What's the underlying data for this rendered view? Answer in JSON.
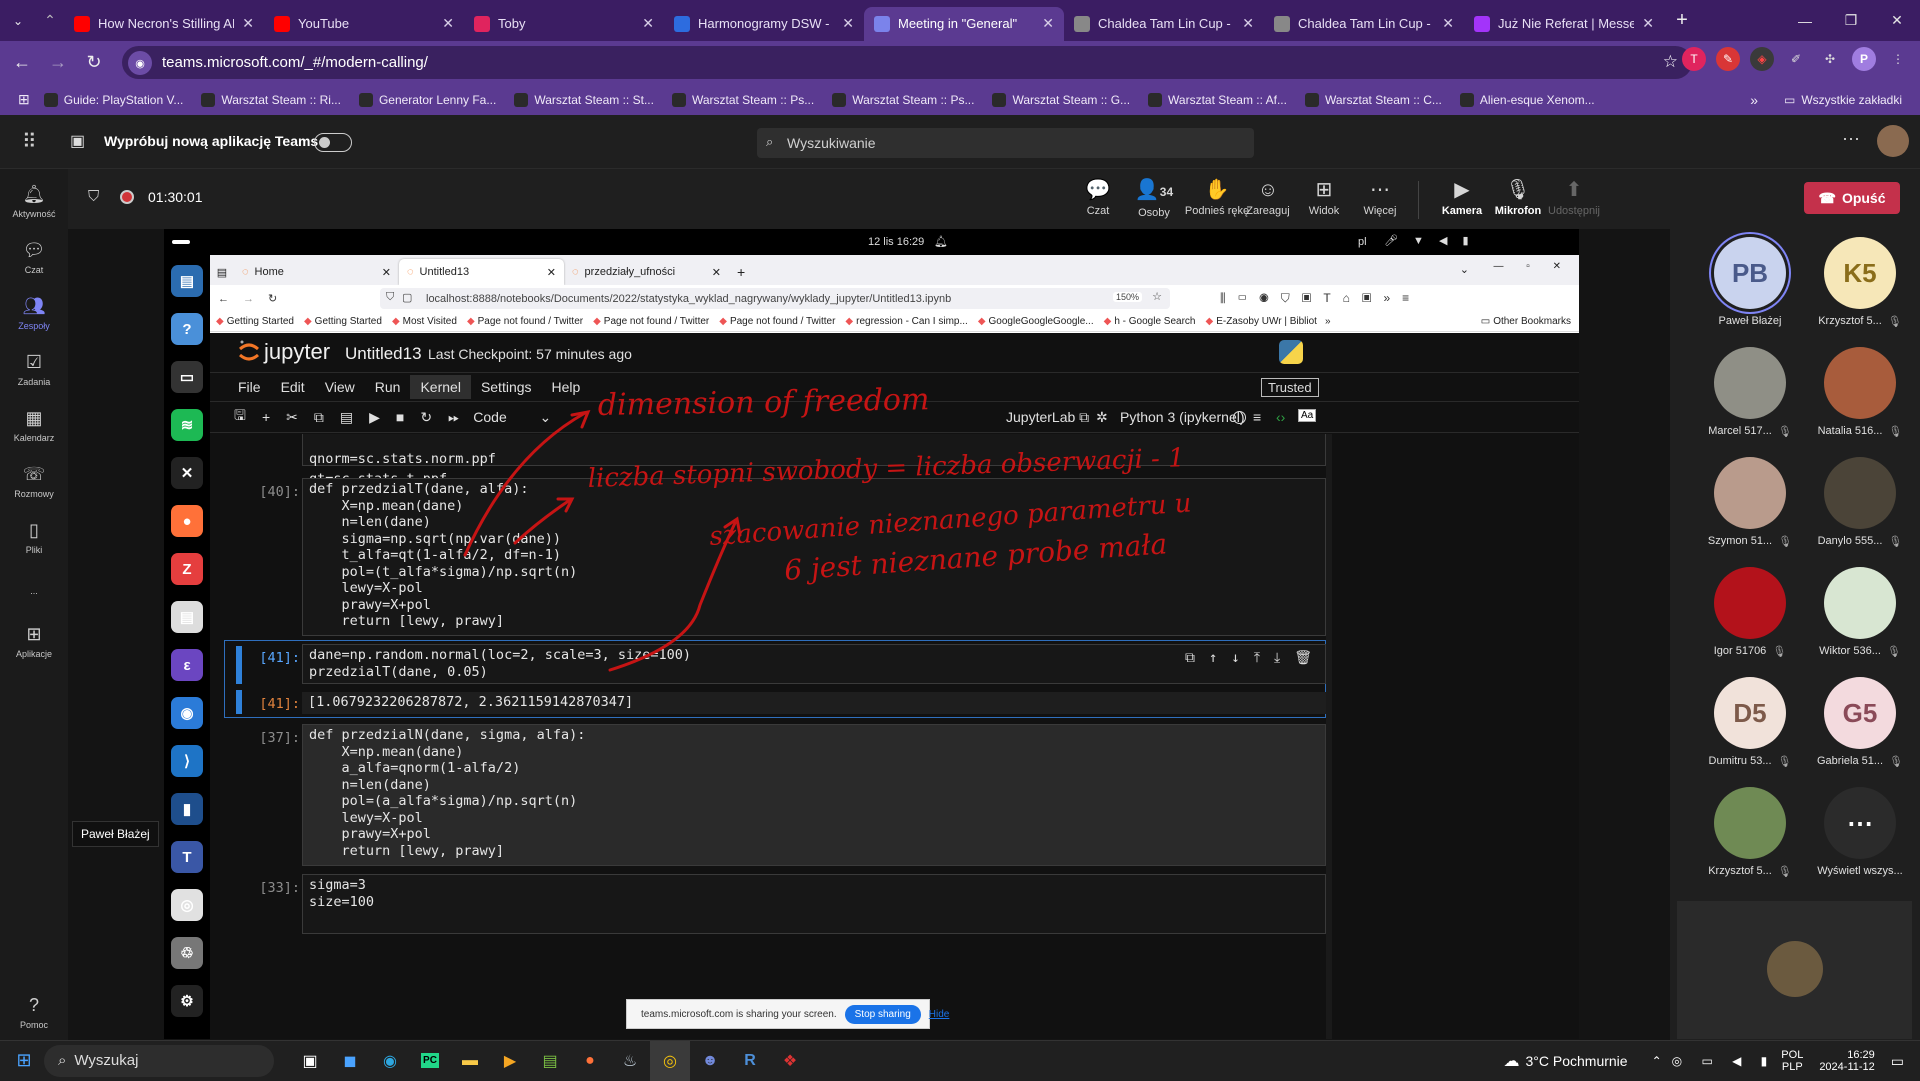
{
  "browser_tabs": [
    {
      "title": "How Necron's Stilling AF",
      "icon": "youtube-icon",
      "color": "#ff0000"
    },
    {
      "title": "YouTube",
      "icon": "youtube-icon",
      "color": "#ff0000"
    },
    {
      "title": "Toby",
      "icon": "toby-icon",
      "color": "#e0245e"
    },
    {
      "title": "Harmonogramy DSW - P",
      "icon": "wd-icon",
      "color": "#2d6cdf"
    },
    {
      "title": "Meeting in \"General\"",
      "icon": "teams-icon",
      "color": "#7b83eb"
    },
    {
      "title": "Chaldea Tam Lin Cup - W",
      "icon": "site-icon",
      "color": "#888888"
    },
    {
      "title": "Chaldea Tam Lin Cup - E",
      "icon": "site-icon",
      "color": "#888888"
    },
    {
      "title": "Już Nie Referat | Messen",
      "icon": "messenger-icon",
      "color": "#a334fa"
    }
  ],
  "address": {
    "url": "teams.microsoft.com/_#/modern-calling/"
  },
  "bookmarks": [
    "Guide: PlayStation V...",
    "Warsztat Steam :: Ri...",
    "Generator Lenny Fa...",
    "Warsztat Steam :: St...",
    "Warsztat Steam :: Ps...",
    "Warsztat Steam :: Ps...",
    "Warsztat Steam :: G...",
    "Warsztat Steam :: Af...",
    "Warsztat Steam :: C...",
    "Alien-esque Xenom..."
  ],
  "bookmarks_all": "Wszystkie zakładki",
  "teams": {
    "try_new": "Wypróbuj nową aplikację Teams",
    "search_placeholder": "Wyszukiwanie",
    "timer": "01:30:01",
    "rail": [
      {
        "label": "Aktywność",
        "icon": "bell-icon"
      },
      {
        "label": "Czat",
        "icon": "chat-icon"
      },
      {
        "label": "Zespoły",
        "icon": "teams-icon"
      },
      {
        "label": "Zadania",
        "icon": "tasks-icon"
      },
      {
        "label": "Kalendarz",
        "icon": "calendar-icon"
      },
      {
        "label": "Rozmowy",
        "icon": "phone-icon"
      },
      {
        "label": "Pliki",
        "icon": "files-icon"
      },
      {
        "label": "...",
        "icon": "more-icon"
      },
      {
        "label": "Aplikacje",
        "icon": "apps-icon"
      }
    ],
    "help": "Pomoc",
    "tooltip": "Paweł Błażej",
    "controls": {
      "chat": "Czat",
      "people": "Osoby",
      "people_count": "34",
      "raise": "Podnieś rękę",
      "react": "Zareaguj",
      "view": "Widok",
      "more": "Więcej",
      "camera": "Kamera",
      "mic": "Mikrofon",
      "share": "Udostępnij",
      "leave": "Opuść"
    }
  },
  "participants": [
    {
      "initials": "PB",
      "name": "Paweł Błażej",
      "bg": "#c9d3ee",
      "fg": "#4a5a8a"
    },
    {
      "initials": "K5",
      "name": "Krzysztof 5...",
      "bg": "#f6e7b8",
      "fg": "#8a6d1a"
    },
    {
      "initials": "",
      "name": "Marcel 517...",
      "bg": "#8f8f86",
      "fg": "#fff"
    },
    {
      "initials": "",
      "name": "Natalia 516...",
      "bg": "#a85c3c",
      "fg": "#fff"
    },
    {
      "initials": "",
      "name": "Szymon 51...",
      "bg": "#b99b8c",
      "fg": "#fff"
    },
    {
      "initials": "",
      "name": "Danylo 555...",
      "bg": "#4b4438",
      "fg": "#fff"
    },
    {
      "initials": "",
      "name": "Igor 51706",
      "bg": "#b3121b",
      "fg": "#fff"
    },
    {
      "initials": "",
      "name": "Wiktor 536...",
      "bg": "#d8e6d2",
      "fg": "#fff"
    },
    {
      "initials": "D5",
      "name": "Dumitru 53...",
      "bg": "#f1e2da",
      "fg": "#7d5a4a"
    },
    {
      "initials": "G5",
      "name": "Gabriela 51...",
      "bg": "#f3dade",
      "fg": "#8a4a58"
    },
    {
      "initials": "",
      "name": "Krzysztof 5...",
      "bg": "#6f8a54",
      "fg": "#fff"
    },
    {
      "initials": "⋯",
      "name": "Wyświetl wszys...",
      "bg": "#2b2b2b",
      "fg": "#fff"
    }
  ],
  "shared": {
    "ubuntu_clock": "12 lis  16:29",
    "ubuntu_lang": "pl",
    "ff_tabs": [
      "Home",
      "Untitled13",
      "przedziały_ufności"
    ],
    "ff_url": "localhost:8888/notebooks/Documents/2022/statystyka_wyklad_nagrywany/wyklady_jupyter/Untitled13.ipynb",
    "ff_zoom": "150%",
    "ff_bookmarks": [
      "Getting Started",
      "Getting Started",
      "Most Visited",
      "Page not found / Twitter",
      "Page not found / Twitter",
      "Page not found / Twitter",
      "regression - Can I simp...",
      "GoogleGoogleGoogle...",
      "h - Google Search",
      "E-Zasoby UWr | Bibliot"
    ],
    "ff_other": "Other Bookmarks",
    "jupyter": {
      "logo": "jupyter",
      "title": "Untitled13",
      "checkpoint": "Last Checkpoint: 57 minutes ago",
      "trusted": "Trusted",
      "menu": [
        "File",
        "Edit",
        "View",
        "Run",
        "Kernel",
        "Settings",
        "Help"
      ],
      "celltype": "Code",
      "jupyterlab": "JupyterLab",
      "kernel": "Python 3 (ipykernel)",
      "cells": [
        {
          "prompt": "",
          "lines": [
            "qnorm=sc.stats.norm.ppf",
            "qt=sc.stats.t.ppf"
          ]
        },
        {
          "prompt": "[40]:",
          "lines": [
            "def przedzialT(dane, alfa):",
            "    X=np.mean(dane)",
            "    n=len(dane)",
            "    sigma=np.sqrt(np.var(dane))",
            "    t_alfa=qt(1-alfa/2, df=n-1)",
            "    pol=(t_alfa*sigma)/np.sqrt(n)",
            "    lewy=X-pol",
            "    prawy=X+pol",
            "    return [lewy, prawy]"
          ]
        },
        {
          "prompt": "[41]:",
          "lines": [
            "dane=np.random.normal(loc=2, scale=3, size=100)",
            "przedzialT(dane, 0.05)"
          ],
          "output_prompt": "[41]:",
          "output": "[1.0679232206287872, 2.3621159142870347]"
        },
        {
          "prompt": "[37]:",
          "lines": [
            "def przedzialN(dane, sigma, alfa):",
            "    X=np.mean(dane)",
            "    a_alfa=qnorm(1-alfa/2)",
            "    n=len(dane)",
            "    pol=(a_alfa*sigma)/np.sqrt(n)",
            "    lewy=X-pol",
            "    prawy=X+pol",
            "    return [lewy, prawy]"
          ]
        },
        {
          "prompt": "[33]:",
          "lines": [
            "sigma=3",
            "size=100"
          ]
        }
      ]
    },
    "annotations": [
      "dimension of freedom",
      "liczba stopni swobody = liczba obserwacji - 1",
      "szacowanie nieznanego parametru u",
      "6 jest nieznane  probe mała"
    ],
    "share_notice": "teams.microsoft.com is sharing your screen.",
    "stop_sharing": "Stop sharing",
    "hide": "Hide"
  },
  "taskbar": {
    "search": "Wyszukaj",
    "weather": "3°C  Pochmurnie",
    "lang1": "POL",
    "lang2": "PLP",
    "time": "16:29",
    "date": "2024-11-12"
  }
}
